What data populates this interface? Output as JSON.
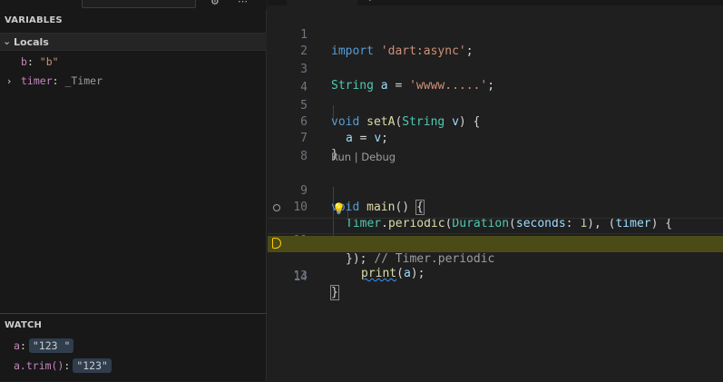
{
  "debug_panel": {
    "variables_title": "VARIABLES",
    "locals_label": "Locals",
    "locals": [
      {
        "name": "b",
        "value": "\"b\""
      },
      {
        "name": "timer",
        "value": "_Timer"
      }
    ],
    "watch_title": "WATCH",
    "watch": [
      {
        "expr": "a",
        "value": "\"123 \""
      },
      {
        "expr": "a.trim()",
        "value": "\"123\""
      }
    ]
  },
  "editor": {
    "codelens": "Run | Debug",
    "lines": [
      {
        "n": "1"
      },
      {
        "n": "2"
      },
      {
        "n": "3"
      },
      {
        "n": "4"
      },
      {
        "n": "5"
      },
      {
        "n": "6"
      },
      {
        "n": "7"
      },
      {
        "n": "8"
      },
      {
        "n": "9"
      },
      {
        "n": "10"
      },
      {
        "n": "11"
      },
      {
        "n": "12"
      },
      {
        "n": "13"
      },
      {
        "n": "14"
      }
    ],
    "tokens": {
      "l1_kw": "import",
      "l1_str": "'dart:async'",
      "l1_end": ";",
      "l3_type": "String",
      "l3_var": "a",
      "l3_eq": " = ",
      "l3_str": "'wwww.....'",
      "l3_end": ";",
      "l5_kw": "void",
      "l5_fn": "setA",
      "l5_open": "(",
      "l5_type": "String",
      "l5_param": "v",
      "l5_close": ") {",
      "l6_var": "a",
      "l6_eq": " = ",
      "l6_val": "v",
      "l6_end": ";",
      "l7_close": "}",
      "l9_kw": "void",
      "l9_fn": "main",
      "l9_paren": "() ",
      "l9_brace": "{",
      "l10_type": "Timer",
      "l10_dot": ".",
      "l10_fn": "periodic",
      "l10_p1": "(",
      "l10_type2": "Duration",
      "l10_p2": "(",
      "l10_param": "seconds",
      "l10_colon": ": ",
      "l10_num": "1",
      "l10_p3": "), (",
      "l10_arg": "timer",
      "l10_p4": ") {",
      "l11_fn": "print",
      "l11_p1": "(",
      "l11_var": "a",
      "l11_p2": ");",
      "l12_close": "});",
      "l12_comment": "// Timer.periodic",
      "l13_close": "}"
    }
  }
}
